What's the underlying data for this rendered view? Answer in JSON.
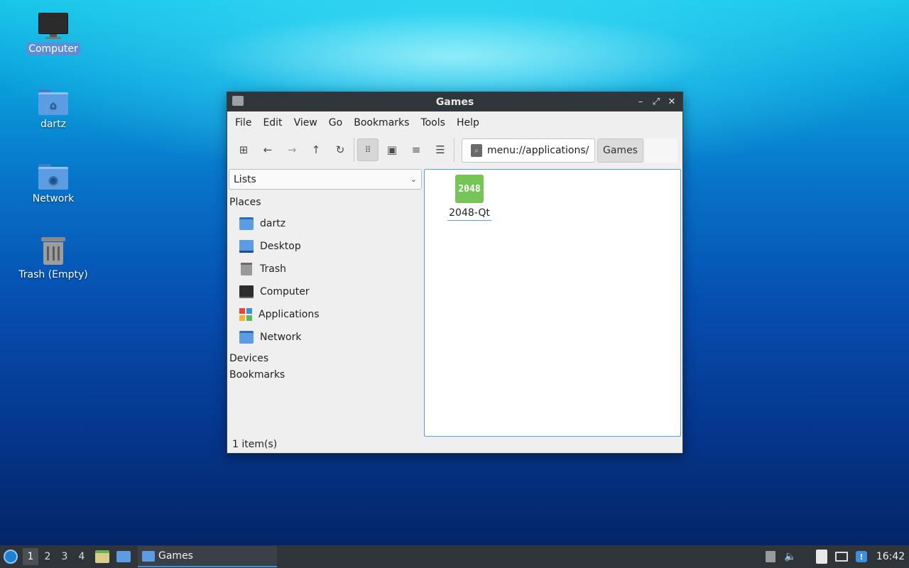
{
  "desktop": {
    "icons": [
      {
        "label": "Computer",
        "icon": "computer-icon"
      },
      {
        "label": "dartz",
        "icon": "home-folder-icon"
      },
      {
        "label": "Network",
        "icon": "network-folder-icon"
      },
      {
        "label": "Trash (Empty)",
        "icon": "trash-icon"
      }
    ]
  },
  "window": {
    "title": "Games",
    "controls": {
      "minimize": "–",
      "maximize": "⤢",
      "close": "✕"
    },
    "menu": [
      "File",
      "Edit",
      "View",
      "Go",
      "Bookmarks",
      "Tools",
      "Help"
    ],
    "toolbar": {
      "path": "menu://applications/",
      "breadcrumb": "Games"
    },
    "sidebar": {
      "combo_value": "Lists",
      "sections": {
        "places": "Places",
        "devices": "Devices",
        "bookmarks": "Bookmarks"
      },
      "places": [
        {
          "label": "dartz",
          "icon": "home-folder-icon"
        },
        {
          "label": "Desktop",
          "icon": "desktop-icon"
        },
        {
          "label": "Trash",
          "icon": "trash-icon"
        },
        {
          "label": "Computer",
          "icon": "computer-icon"
        },
        {
          "label": "Applications",
          "icon": "applications-icon"
        },
        {
          "label": "Network",
          "icon": "network-folder-icon"
        }
      ]
    },
    "files": [
      {
        "name": "2048-Qt",
        "icon_text": "2048",
        "icon_color": "#77c457"
      }
    ],
    "status": "1 item(s)"
  },
  "taskbar": {
    "workspaces": [
      "1",
      "2",
      "3",
      "4"
    ],
    "current_workspace": "1",
    "task": {
      "label": "Games"
    },
    "clock": "16:42",
    "accent": "#3c8ee0"
  }
}
